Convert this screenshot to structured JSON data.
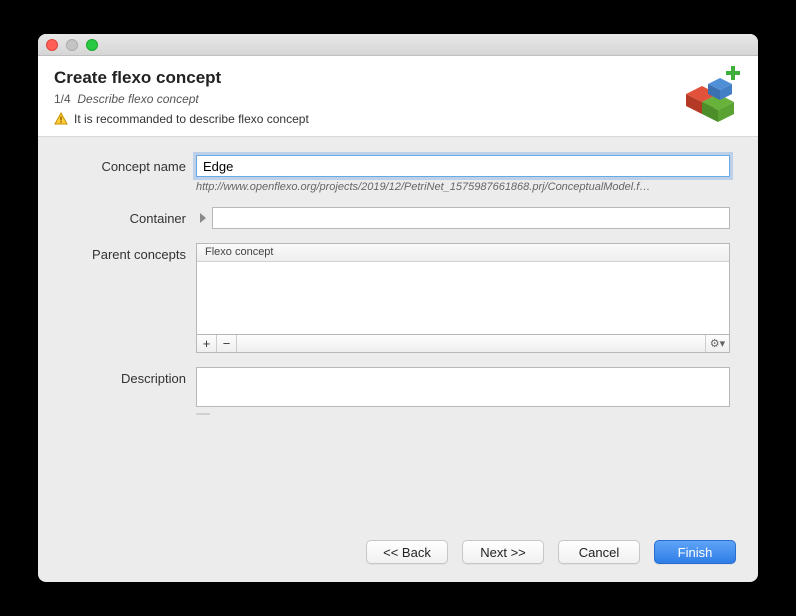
{
  "header": {
    "title": "Create flexo concept",
    "step_num": "1/4",
    "step_desc": "Describe flexo concept",
    "warning": "It is recommanded to describe flexo concept"
  },
  "form": {
    "concept_name_label": "Concept name",
    "concept_name_value": "Edge",
    "concept_uri": "http://www.openflexo.org/projects/2019/12/PetriNet_1575987661868.prj/ConceptualModel.f…",
    "container_label": "Container",
    "container_value": "",
    "parent_concepts_label": "Parent concepts",
    "parent_concepts_header": "Flexo concept",
    "description_label": "Description",
    "description_value": ""
  },
  "buttons": {
    "back": "<< Back",
    "next": "Next >>",
    "cancel": "Cancel",
    "finish": "Finish"
  },
  "icons": {
    "add": "+",
    "remove": "−",
    "gear": "⚙▾"
  }
}
